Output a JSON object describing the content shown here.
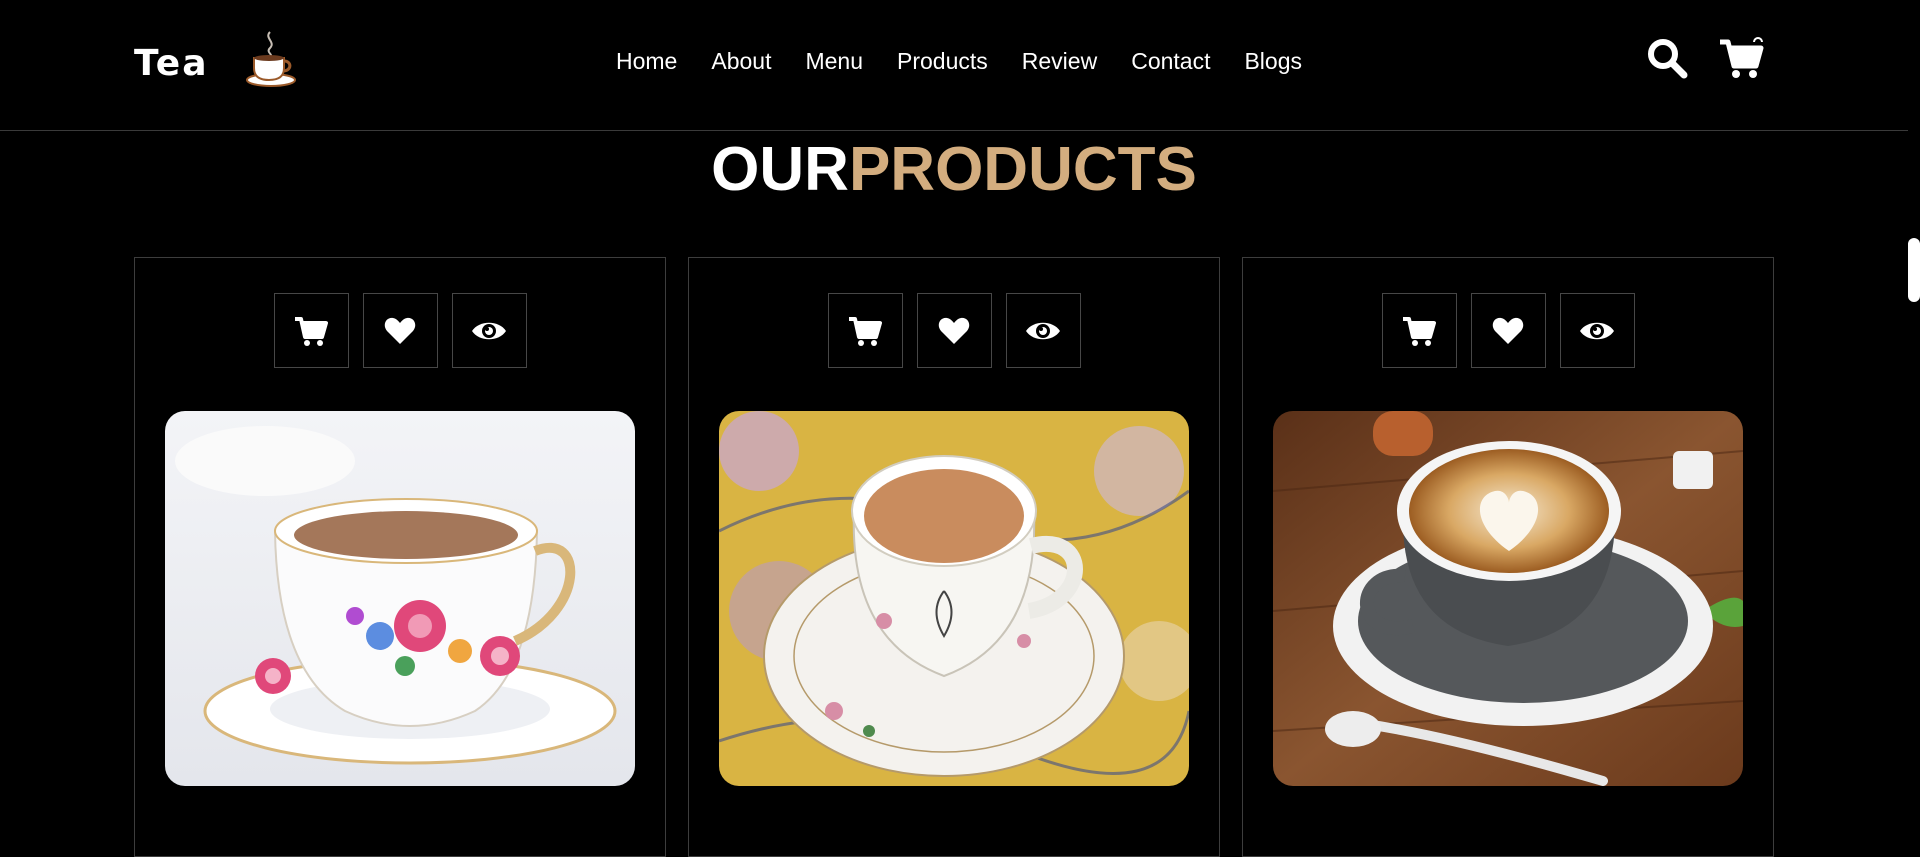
{
  "header": {
    "logo_text": "Tea",
    "nav": [
      {
        "label": "Home"
      },
      {
        "label": "About"
      },
      {
        "label": "Menu"
      },
      {
        "label": "Products"
      },
      {
        "label": "Review"
      },
      {
        "label": "Contact"
      },
      {
        "label": "Blogs"
      }
    ],
    "icons": [
      "search-icon",
      "cart-icon"
    ]
  },
  "products_section": {
    "title_part1": "OUR",
    "title_part2": "PRODUCTS",
    "accent_color": "#d3ad7f",
    "cards": [
      {
        "image": "floral-teacup-with-milk-tea",
        "actions": [
          "cart-icon",
          "heart-icon",
          "eye-icon"
        ]
      },
      {
        "image": "chai-cup-on-floral-saucer",
        "actions": [
          "cart-icon",
          "heart-icon",
          "eye-icon"
        ]
      },
      {
        "image": "latte-art-cup-on-wood",
        "actions": [
          "cart-icon",
          "heart-icon",
          "eye-icon"
        ]
      }
    ]
  }
}
